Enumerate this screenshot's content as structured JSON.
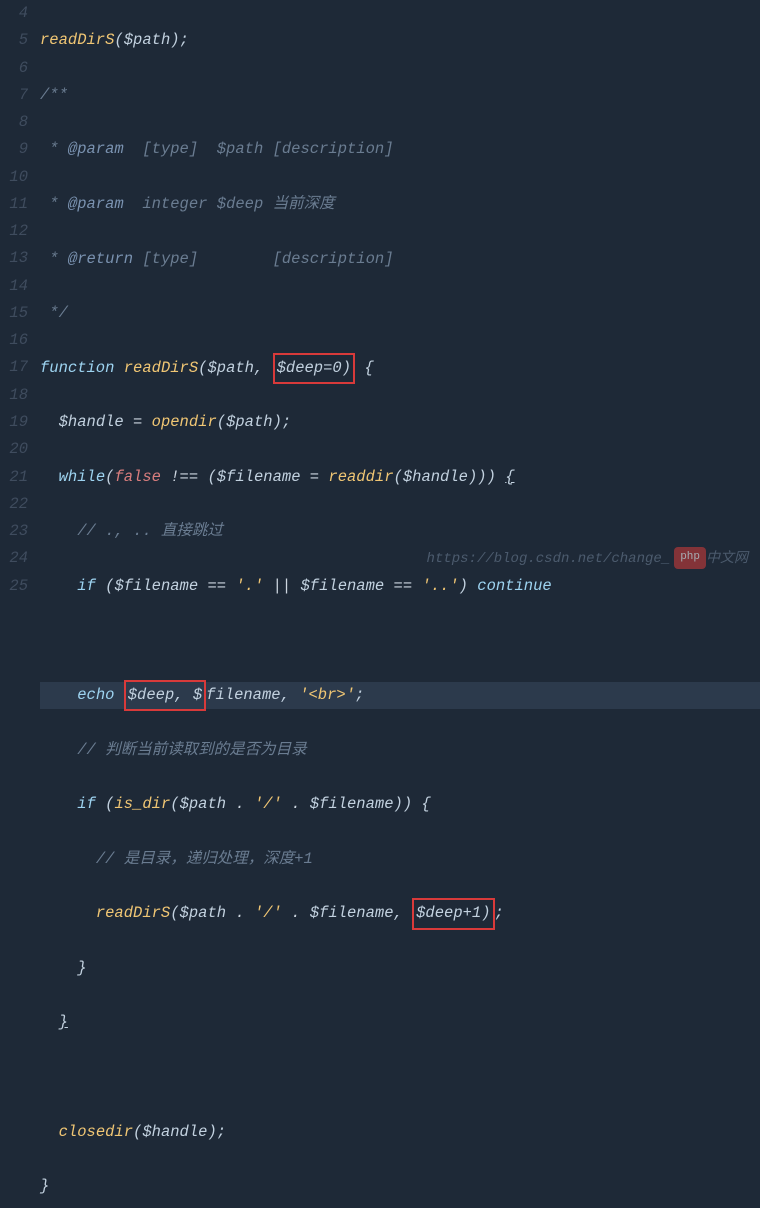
{
  "gutter": {
    "start": 4,
    "end": 25
  },
  "code": {
    "l4": {
      "fn": "readDirS",
      "p": "(",
      "var": "$path",
      "cl": ");"
    },
    "l5": {
      "c": "/**"
    },
    "l6": {
      "pre": " * ",
      "tag": "@param",
      "sp1": "  ",
      "type": "[type]",
      "sp2": "  ",
      "var": "$path",
      "sp3": " ",
      "desc": "[description]"
    },
    "l7": {
      "pre": " * ",
      "tag": "@param",
      "sp1": "  ",
      "type": "integer",
      "sp2": " ",
      "var": "$deep",
      "sp3": " ",
      "desc": "当前深度"
    },
    "l8": {
      "pre": " * ",
      "tag": "@return",
      "sp1": " ",
      "type": "[type]",
      "sp2": "        ",
      "desc": "[description]"
    },
    "l9": {
      "c": " */"
    },
    "l10": {
      "kw": "function",
      "sp": " ",
      "fn": "readDirS",
      "p1": "(",
      "v1": "$path",
      "comma": ", ",
      "box": "$deep=0)",
      "sp2": " ",
      "brace": "{"
    },
    "l11": {
      "ind": "  ",
      "v1": "$handle",
      "eq": " = ",
      "fn": "opendir",
      "p1": "(",
      "v2": "$path",
      "cl": ");"
    },
    "l12": {
      "ind": "  ",
      "kw1": "while",
      "p1": "(",
      "kw2": "false",
      "neq": " !== ",
      "p2": "(",
      "v1": "$filename",
      "eq": " = ",
      "fn": "readdir",
      "p3": "(",
      "v2": "$handle",
      "cl": "))) ",
      "brace": "{"
    },
    "l13": {
      "ind": "    ",
      "c": "// ., .. 直接跳过"
    },
    "l14": {
      "ind": "    ",
      "kw": "if",
      "p1": " (",
      "v1": "$filename",
      "eq1": " == ",
      "s1": "'.'",
      "or": " || ",
      "v2": "$filename",
      "eq2": " == ",
      "s2": "'..'",
      "cl": ") ",
      "cont": "continue"
    },
    "l15": "",
    "l16": {
      "ind": "    ",
      "kw": "echo",
      "sp": " ",
      "box": "$deep, $",
      "v": "filename",
      "c": ", ",
      "s": "'<br>'",
      "end": ";"
    },
    "l17": {
      "ind": "    ",
      "c": "// 判断当前读取到的是否为目录"
    },
    "l18": {
      "ind": "    ",
      "kw": "if",
      "p1": " (",
      "fn": "is_dir",
      "p2": "(",
      "v1": "$path",
      "cat1": " . ",
      "s1": "'/'",
      "cat2": " . ",
      "v2": "$filename",
      "cl": ")) ",
      "brace": "{"
    },
    "l19": {
      "ind": "      ",
      "c": "// 是目录，递归处理，深度+1"
    },
    "l20": {
      "ind": "      ",
      "fn": "readDirS",
      "p1": "(",
      "v1": "$path",
      "cat1": " . ",
      "s1": "'/'",
      "cat2": " . ",
      "v2": "$filename",
      "comma": ", ",
      "box": "$deep+1)",
      "end": ";"
    },
    "l21": {
      "ind": "    ",
      "brace": "}"
    },
    "l22": {
      "ind": "  ",
      "brace": "}"
    },
    "l23": "",
    "l24": {
      "ind": "  ",
      "fn": "closedir",
      "p1": "(",
      "v1": "$handle",
      "cl": ");"
    },
    "l25": {
      "brace": "}"
    }
  },
  "watermark": {
    "url": "https://blog.csdn.net/change_",
    "badge": "php",
    "cn": "中文网"
  }
}
